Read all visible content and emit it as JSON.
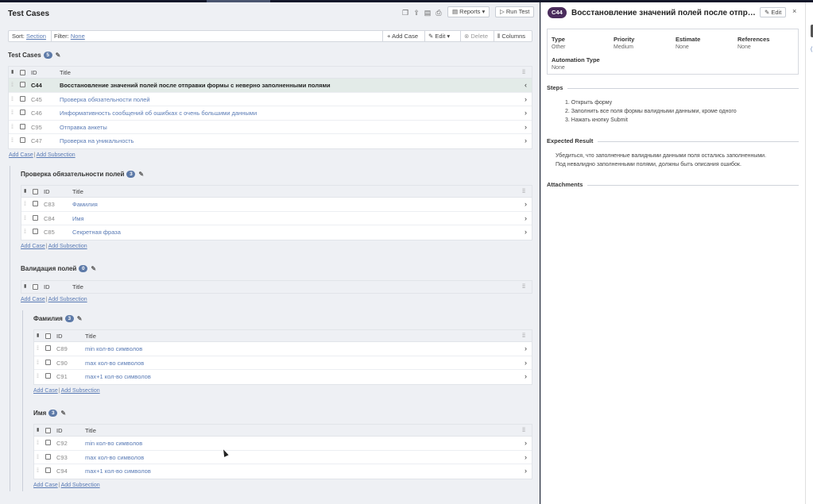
{
  "window": {
    "title": "Test Cases"
  },
  "toolbar_icons": [
    "copy-icon",
    "export-icon",
    "pdf-icon",
    "print-icon"
  ],
  "header": {
    "reports_label": "Reports",
    "run_test_label": "Run Test"
  },
  "filterbar": {
    "sort_label": "Sort:",
    "sort_value": "Section",
    "filter_label": "Filter:",
    "filter_value": "None",
    "add_case": "Add Case",
    "edit": "Edit",
    "delete": "Delete",
    "columns": "Columns"
  },
  "columns": {
    "id": "ID",
    "title": "Title"
  },
  "links": {
    "add_case": "Add Case",
    "add_subsection": "Add Subsection",
    "sep": "|"
  },
  "sections": [
    {
      "name": "Test Cases",
      "count": "5",
      "rows": [
        {
          "id": "C44",
          "title": "Восстановление значений полей после отправки формы с неверно заполненными полями",
          "selected": true
        },
        {
          "id": "C45",
          "title": "Проверка обязательности полей"
        },
        {
          "id": "C46",
          "title": "Информативность сообщений об ошибках с очень большими данными"
        },
        {
          "id": "C95",
          "title": "Отправка анкеты"
        },
        {
          "id": "C47",
          "title": "Проверка на уникальность"
        }
      ]
    },
    {
      "name": "Проверка обязательности полей",
      "count": "3",
      "rows": [
        {
          "id": "C83",
          "title": "Фамилия"
        },
        {
          "id": "C84",
          "title": "Имя"
        },
        {
          "id": "C85",
          "title": "Секретная фраза"
        }
      ]
    },
    {
      "name": "Валидация полей",
      "count": "0",
      "rows": []
    },
    {
      "name": "Фамилия",
      "count": "3",
      "rows": [
        {
          "id": "C89",
          "title": "min кол-во символов"
        },
        {
          "id": "C90",
          "title": "max кол-во символов"
        },
        {
          "id": "C91",
          "title": "max+1 кол-во символов"
        }
      ]
    },
    {
      "name": "Имя",
      "count": "3",
      "rows": [
        {
          "id": "C92",
          "title": "min кол-во символов"
        },
        {
          "id": "C93",
          "title": "max кол-во символов"
        },
        {
          "id": "C94",
          "title": "max+1 кол-во символов"
        }
      ]
    }
  ],
  "detail": {
    "id": "C44",
    "title": "Восстановление значений полей после отправки формы с неверно заполненными полями",
    "edit_label": "Edit",
    "close": "×",
    "fields": [
      {
        "key": "Type",
        "value": "Other"
      },
      {
        "key": "Priority",
        "value": "Medium"
      },
      {
        "key": "Estimate",
        "value": "None"
      },
      {
        "key": "References",
        "value": "None"
      },
      {
        "key": "Automation Type",
        "value": "None"
      }
    ],
    "steps_heading": "Steps",
    "steps": [
      "1. Открыть форму",
      "2. Заполнить все поля формы валидными данными, кроме одного",
      "3. Нажать кнопку Submit"
    ],
    "expected_heading": "Expected Result",
    "expected": [
      "Убедиться, что заполненные валидными данными поля остались заполненными.",
      "Под невалидно заполненными полями, должны быть описания ошибок."
    ],
    "attachments_heading": "Attachments"
  },
  "colors": {
    "accent": "#5a7bb5",
    "badge": "#5d7aa8",
    "id_badge": "#4a2c5c",
    "selected_row": "#e3ebe8"
  }
}
